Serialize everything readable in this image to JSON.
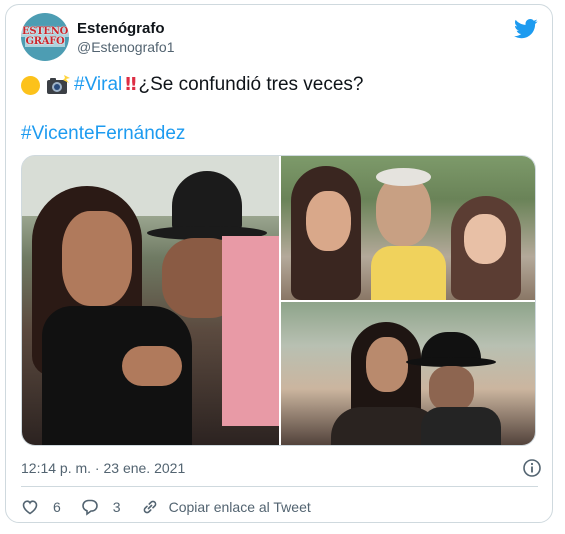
{
  "tweet": {
    "author_name": "Estenógrafo",
    "author_handle": "@Estenografo1",
    "avatar_text_line1": "ESTENO",
    "avatar_text_line2": "GRAFO",
    "text_hashtag1": "#Viral",
    "text_question": "¿Se confundió tres veces?",
    "text_hashtag2": "#VicenteFernández",
    "timestamp": "12:14 p. m. · 23 ene. 2021",
    "like_count": "6",
    "reply_count": "3",
    "copy_link_label": "Copiar enlace al Tweet"
  },
  "colors": {
    "accent": "#1d9bf0",
    "secondary_text": "#536471",
    "border": "#cfd9de"
  },
  "icons": [
    "twitter-bird-icon",
    "yellow-circle-emoji",
    "camera-flash-emoji",
    "double-exclamation-emoji",
    "info-icon",
    "heart-icon",
    "reply-icon",
    "link-icon"
  ]
}
